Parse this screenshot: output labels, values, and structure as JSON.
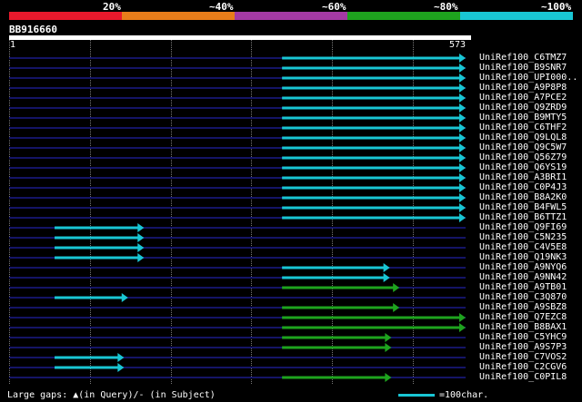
{
  "legend": {
    "labels": [
      "20%",
      "~40%",
      "~60%",
      "~80%",
      "~100%"
    ],
    "colors": [
      "#e8192c",
      "#e87d1a",
      "#a43aa4",
      "#1ea31e",
      "#19c6d4"
    ]
  },
  "query": {
    "name": "BB916660",
    "start": "1",
    "end": "573"
  },
  "footer": {
    "gaps_text": "Large gaps: ▲(in Query)/- (in Subject)",
    "scale_text": "=100char."
  },
  "hits": [
    {
      "label": "UniRef100_C6TMZ7",
      "start": 343,
      "end": 573,
      "color": "#19c6d4"
    },
    {
      "label": "UniRef100_B9SNR7",
      "start": 343,
      "end": 573,
      "color": "#19c6d4"
    },
    {
      "label": "UniRef100_UPI000..",
      "start": 343,
      "end": 573,
      "color": "#19c6d4"
    },
    {
      "label": "UniRef100_A9P8P8",
      "start": 343,
      "end": 573,
      "color": "#19c6d4"
    },
    {
      "label": "UniRef100_A7PCE2",
      "start": 343,
      "end": 573,
      "color": "#19c6d4"
    },
    {
      "label": "UniRef100_Q9ZRD9",
      "start": 343,
      "end": 573,
      "color": "#19c6d4"
    },
    {
      "label": "UniRef100_B9MTY5",
      "start": 343,
      "end": 573,
      "color": "#19c6d4"
    },
    {
      "label": "UniRef100_C6THF2",
      "start": 343,
      "end": 573,
      "color": "#19c6d4"
    },
    {
      "label": "UniRef100_Q9LQL8",
      "start": 343,
      "end": 573,
      "color": "#19c6d4"
    },
    {
      "label": "UniRef100_Q9C5W7",
      "start": 343,
      "end": 573,
      "color": "#19c6d4"
    },
    {
      "label": "UniRef100_Q56Z79",
      "start": 343,
      "end": 573,
      "color": "#19c6d4"
    },
    {
      "label": "UniRef100_Q6YS19",
      "start": 343,
      "end": 573,
      "color": "#19c6d4"
    },
    {
      "label": "UniRef100_A3BRI1",
      "start": 343,
      "end": 573,
      "color": "#19c6d4"
    },
    {
      "label": "UniRef100_C0P4J3",
      "start": 343,
      "end": 573,
      "color": "#19c6d4"
    },
    {
      "label": "UniRef100_B8A2K0",
      "start": 343,
      "end": 573,
      "color": "#19c6d4"
    },
    {
      "label": "UniRef100_B4FWL5",
      "start": 343,
      "end": 573,
      "color": "#19c6d4"
    },
    {
      "label": "UniRef100_B6TTZ1",
      "start": 343,
      "end": 573,
      "color": "#19c6d4"
    },
    {
      "label": "UniRef100_Q9FI69",
      "start": 58,
      "end": 170,
      "color": "#19c6d4"
    },
    {
      "label": "UniRef100_C5N235",
      "start": 58,
      "end": 170,
      "color": "#19c6d4"
    },
    {
      "label": "UniRef100_C4V5E8",
      "start": 58,
      "end": 170,
      "color": "#19c6d4"
    },
    {
      "label": "UniRef100_Q19NK3",
      "start": 58,
      "end": 170,
      "color": "#19c6d4"
    },
    {
      "label": "UniRef100_A9NYQ6",
      "start": 343,
      "end": 478,
      "color": "#19c6d4"
    },
    {
      "label": "UniRef100_A9NN42",
      "start": 343,
      "end": 478,
      "color": "#19c6d4"
    },
    {
      "label": "UniRef100_A9TB01",
      "start": 343,
      "end": 490,
      "color": "#1ea31e"
    },
    {
      "label": "UniRef100_C3Q870",
      "start": 58,
      "end": 150,
      "color": "#19c6d4"
    },
    {
      "label": "UniRef100_A9SBZ8",
      "start": 343,
      "end": 490,
      "color": "#1ea31e"
    },
    {
      "label": "UniRef100_Q7EZC8",
      "start": 343,
      "end": 573,
      "color": "#1ea31e"
    },
    {
      "label": "UniRef100_B8BAX1",
      "start": 343,
      "end": 573,
      "color": "#1ea31e"
    },
    {
      "label": "UniRef100_C5YHC9",
      "start": 343,
      "end": 480,
      "color": "#1ea31e"
    },
    {
      "label": "UniRef100_A9S7P3",
      "start": 343,
      "end": 480,
      "color": "#1ea31e"
    },
    {
      "label": "UniRef100_C7VOS2",
      "start": 58,
      "end": 145,
      "color": "#19c6d4"
    },
    {
      "label": "UniRef100_C2CGV6",
      "start": 58,
      "end": 145,
      "color": "#19c6d4"
    },
    {
      "label": "UniRef100_C0PIL8",
      "start": 343,
      "end": 480,
      "color": "#1ea31e"
    }
  ]
}
